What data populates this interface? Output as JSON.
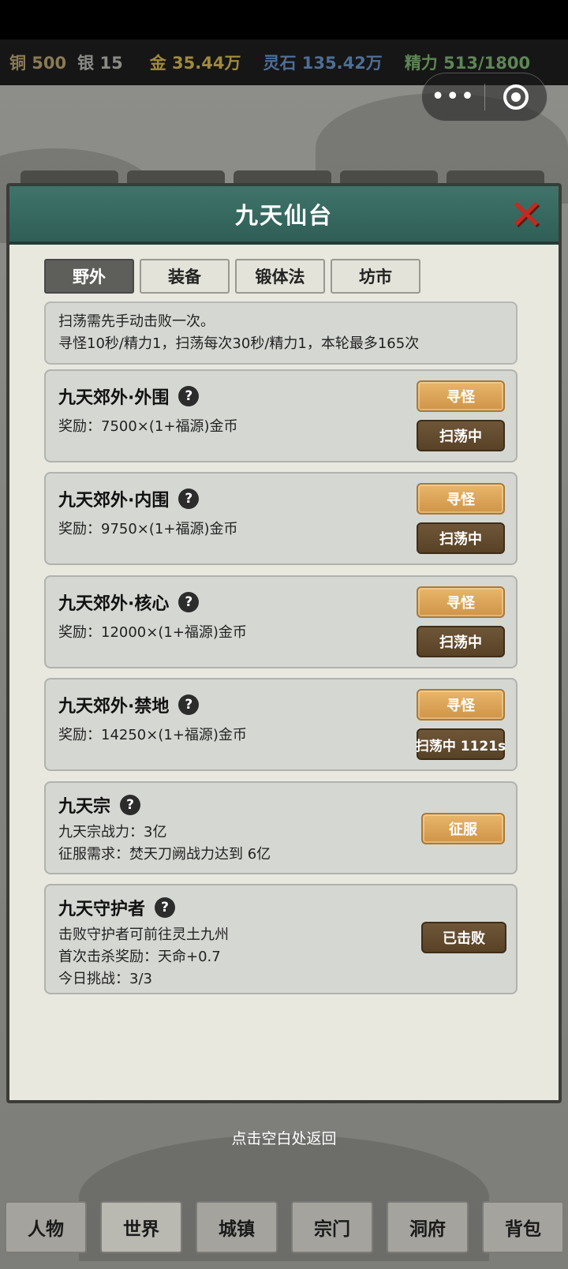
{
  "resources": {
    "copper": "铜 500",
    "silver": "银 15",
    "gold": "金 35.44万",
    "spirit_stone": "灵石 135.42万",
    "energy": "精力 513/1800"
  },
  "capsule": {
    "more_icon": "more-dots-icon",
    "close_icon": "target-ring-icon",
    "more_text": "•••"
  },
  "panel": {
    "title": "九天仙台",
    "close_icon": "close-x-icon",
    "close_glyph": "✕",
    "tabs": [
      {
        "label": "野外",
        "active": true
      },
      {
        "label": "装备",
        "active": false
      },
      {
        "label": "锻体法",
        "active": false
      },
      {
        "label": "坊市",
        "active": false
      }
    ],
    "info_lines": [
      "扫荡需先手动击败一次。",
      "寻怪10秒/精力1，扫荡每次30秒/精力1，本轮最多165次"
    ],
    "help_glyph": "?",
    "cards": [
      {
        "title": "九天郊外·外围",
        "lines": [
          "奖励：7500×(1+福源)金币"
        ],
        "buttons": [
          "寻怪",
          "扫荡中"
        ]
      },
      {
        "title": "九天郊外·内围",
        "lines": [
          "奖励：9750×(1+福源)金币"
        ],
        "buttons": [
          "寻怪",
          "扫荡中"
        ]
      },
      {
        "title": "九天郊外·核心",
        "lines": [
          "奖励：12000×(1+福源)金币"
        ],
        "buttons": [
          "寻怪",
          "扫荡中"
        ]
      },
      {
        "title": "九天郊外·禁地",
        "lines": [
          "奖励：14250×(1+福源)金币"
        ],
        "buttons": [
          "寻怪",
          "扫荡中 1121s"
        ]
      },
      {
        "title": "九天宗",
        "lines": [
          "九天宗战力：3亿",
          "征服需求：焚天刀阙战力达到 6亿"
        ],
        "buttons": [
          "征服"
        ]
      },
      {
        "title": "九天守护者",
        "lines": [
          "击败守护者可前往灵土九州",
          "首次击杀奖励：天命+0.7",
          "今日挑战：3/3"
        ],
        "buttons": [
          "已击败"
        ]
      }
    ]
  },
  "hint": "点击空白处返回",
  "bottom_nav": [
    {
      "label": "人物",
      "active": false
    },
    {
      "label": "世界",
      "active": true
    },
    {
      "label": "城镇",
      "active": false
    },
    {
      "label": "宗门",
      "active": false
    },
    {
      "label": "洞府",
      "active": false
    },
    {
      "label": "背包",
      "active": false
    }
  ],
  "colors": {
    "header_teal": "#3f746b",
    "button_gold": "#e8b66a",
    "button_brown": "#6f5638",
    "close_red": "#c52a20"
  }
}
